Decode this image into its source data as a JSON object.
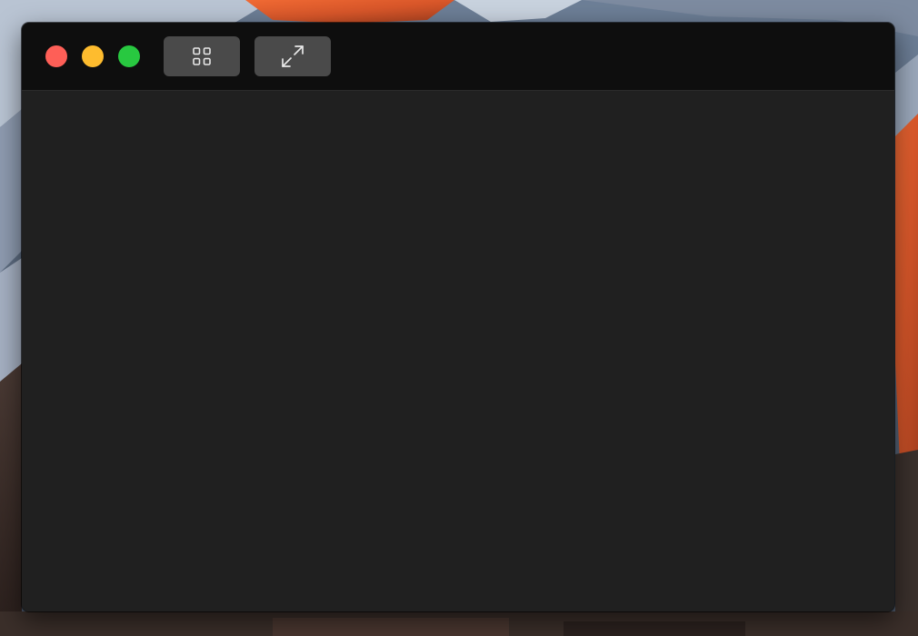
{
  "window": {
    "traffic_lights": [
      {
        "name": "close",
        "color": "#fe5f57"
      },
      {
        "name": "minimize",
        "color": "#febc2e"
      },
      {
        "name": "zoom",
        "color": "#28c840"
      }
    ],
    "toolbar": {
      "buttons": [
        {
          "name": "grid-view",
          "icon": "grid-icon"
        },
        {
          "name": "expand",
          "icon": "expand-arrows-icon"
        }
      ]
    },
    "colors": {
      "titlebar": "#0e0e0e",
      "content": "#202020",
      "button": "#4a4a4a",
      "icon": "#e8e8e8"
    }
  },
  "desktop": {
    "wallpaper": "mountain-sunset"
  }
}
